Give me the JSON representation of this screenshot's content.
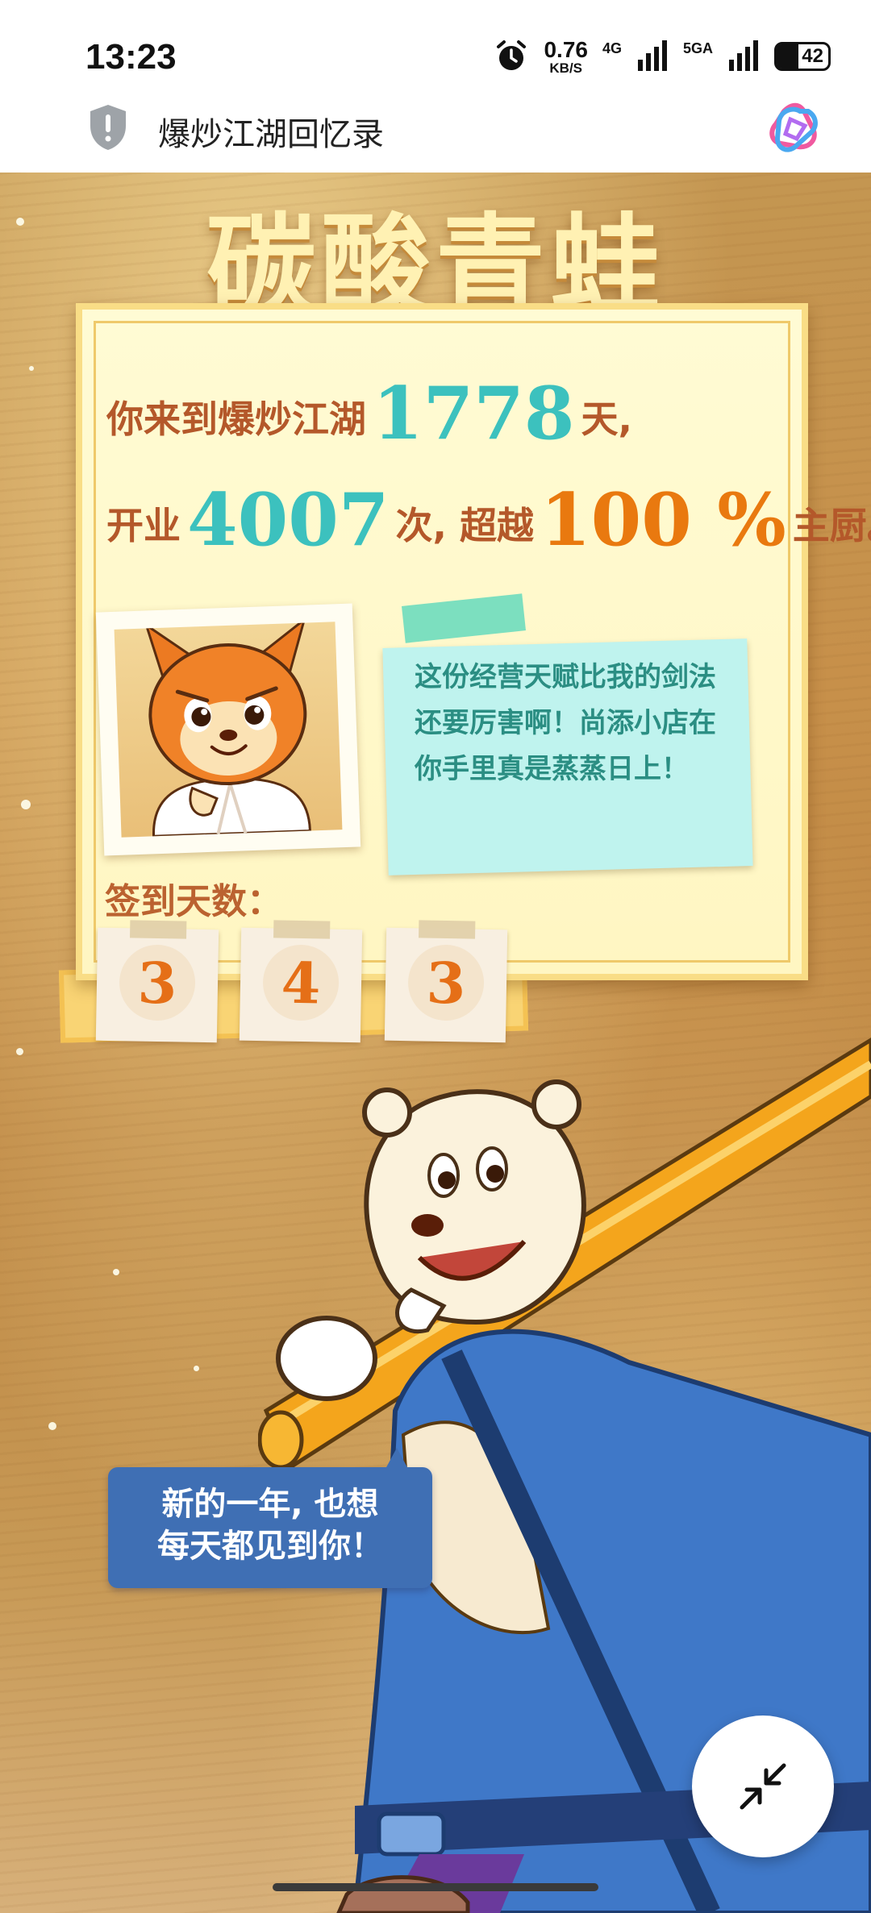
{
  "status_bar": {
    "time": "13:23",
    "net_speed_value": "0.76",
    "net_speed_unit": "KB/S",
    "network_1": "4G",
    "network_2": "5GA",
    "battery_level": "42"
  },
  "title_bar": {
    "title": "爆炒江湖回忆录",
    "security_icon": "shield-icon",
    "app_icon": "app-logo-icon"
  },
  "hero": {
    "name": "碳酸青蛙"
  },
  "summary": {
    "line1_prefix": "你来到爆炒江湖",
    "days": "1778",
    "line1_suffix": "天,",
    "line2_prefix": "开业",
    "opens": "4007",
    "line2_mid": "次, 超越",
    "percent": "100 %",
    "line2_suffix": "主厨。"
  },
  "note": {
    "text": "这份经营天赋比我的剑法还要厉害啊！尚添小店在你手里真是蒸蒸日上！"
  },
  "checkin": {
    "label": "签到天数：",
    "digits": [
      "3",
      "4",
      "3"
    ]
  },
  "bubble": {
    "line1": "新的一年, 也想",
    "line2": "每天都见到你！"
  },
  "colors": {
    "teal": "#3cc1be",
    "orange": "#e9790f",
    "brown": "#b4582a",
    "bubble_blue": "#3f6fb4"
  },
  "fab": {
    "icon": "collapse-arrows-icon"
  }
}
